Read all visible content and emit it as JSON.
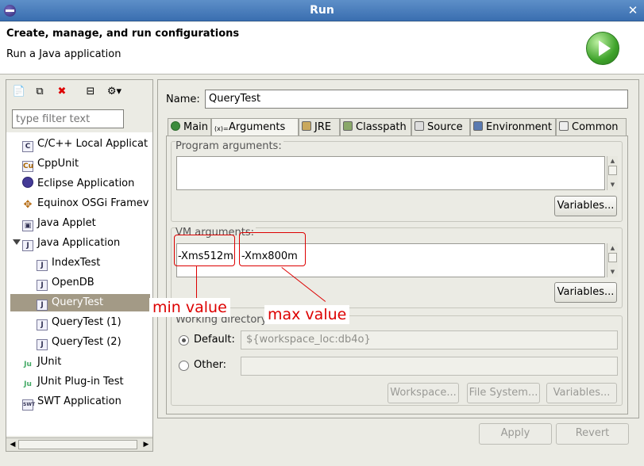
{
  "window": {
    "title": "Run"
  },
  "header": {
    "title": "Create, manage, and run configurations",
    "subtitle": "Run a Java application"
  },
  "left": {
    "filter_placeholder": "type filter text",
    "tree": [
      {
        "label": "C/C++ Local Applicat",
        "icon": "c-app-icon"
      },
      {
        "label": "CppUnit",
        "icon": "cppunit-icon"
      },
      {
        "label": "Eclipse Application",
        "icon": "eclipse-icon"
      },
      {
        "label": "Equinox OSGi Framev",
        "icon": "osgi-icon"
      },
      {
        "label": "Java Applet",
        "icon": "applet-icon"
      },
      {
        "label": "Java Application",
        "icon": "java-app-icon"
      },
      {
        "label": "IndexTest",
        "icon": "java-config-icon"
      },
      {
        "label": "OpenDB",
        "icon": "java-config-icon"
      },
      {
        "label": "QueryTest",
        "icon": "java-config-icon"
      },
      {
        "label": "QueryTest (1)",
        "icon": "java-config-icon"
      },
      {
        "label": "QueryTest (2)",
        "icon": "java-config-icon"
      },
      {
        "label": "JUnit",
        "icon": "junit-icon"
      },
      {
        "label": "JUnit Plug-in Test",
        "icon": "junit-plugin-icon"
      },
      {
        "label": "SWT Application",
        "icon": "swt-icon"
      }
    ]
  },
  "config": {
    "name_label": "Name:",
    "name_value": "QueryTest",
    "tabs": [
      "Main",
      "Arguments",
      "JRE",
      "Classpath",
      "Source",
      "Environment",
      "Common"
    ],
    "program_args_label": "Program arguments:",
    "variables_label": "Variables...",
    "vm_args_label": "VM arguments:",
    "vm_arg_min": "-Xms512m",
    "vm_arg_max": "-Xmx800m",
    "working_dir_label": "Working directory:",
    "default_label": "Default:",
    "default_value": "${workspace_loc:db4o}",
    "other_label": "Other:",
    "workspace_btn": "Workspace...",
    "filesystem_btn": "File System...",
    "variables_btn_dis": "Variables..."
  },
  "annotations": {
    "min": "min value",
    "max": "max value"
  },
  "footer": {
    "apply": "Apply",
    "revert": "Revert"
  }
}
